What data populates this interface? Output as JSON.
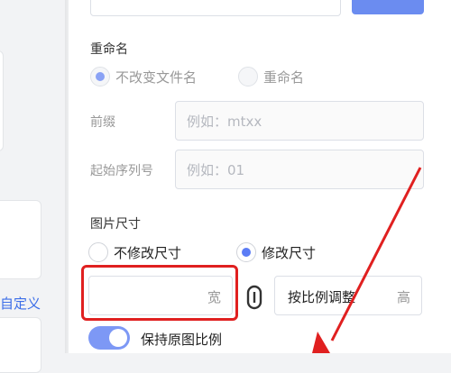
{
  "sidebar": {
    "custom_link": "自定义"
  },
  "rename": {
    "title": "重命名",
    "options": [
      "不改变文件名",
      "重命名"
    ],
    "prefix_label": "前缀",
    "prefix_placeholder": "例如：mtxx",
    "start_seq_label": "起始序列号",
    "start_seq_placeholder": "例如：01"
  },
  "size": {
    "title": "图片尺寸",
    "options": [
      "不修改尺寸",
      "修改尺寸"
    ],
    "width_suffix": "宽",
    "ratio_value": "按比例调整",
    "height_suffix": "高",
    "keep_ratio_label": "保持原图比例",
    "keep_ratio_on": true
  },
  "colors": {
    "accent": "#5b7cf5",
    "highlight": "#e02020"
  },
  "icons": {
    "link": "link-icon"
  }
}
